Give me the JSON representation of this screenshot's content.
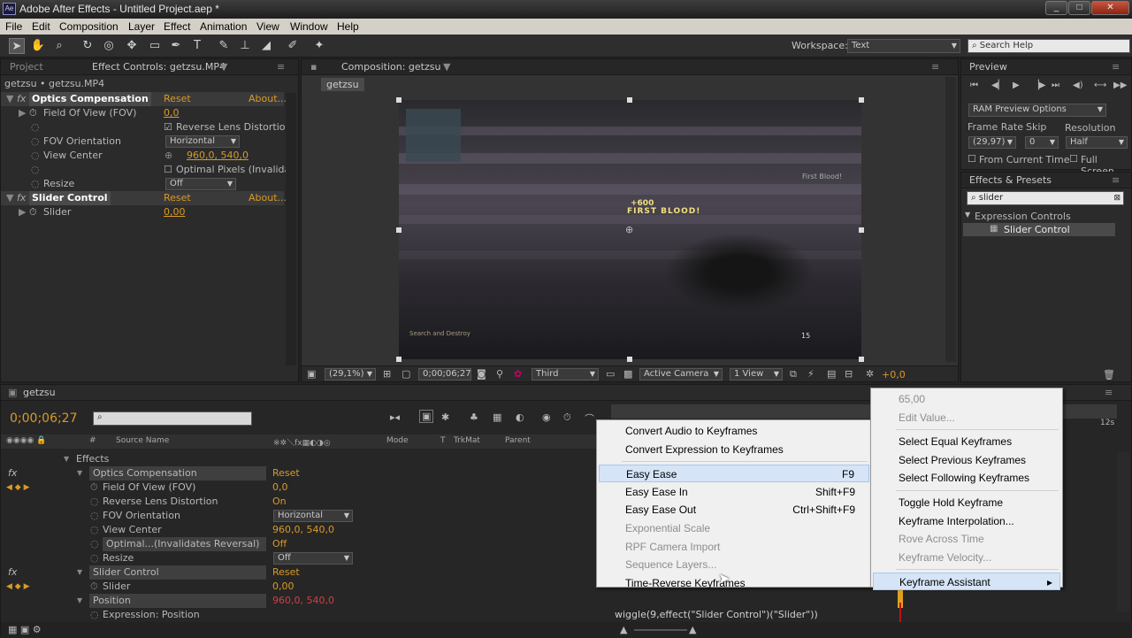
{
  "window": {
    "title": "Adobe After Effects - Untitled Project.aep *",
    "app_icon": "Ae",
    "min": "_",
    "max": "□",
    "close": "✕"
  },
  "menubar": {
    "items": [
      "File",
      "Edit",
      "Composition",
      "Layer",
      "Effect",
      "Animation",
      "View",
      "Window",
      "Help"
    ]
  },
  "toolbar": {
    "workspace_label": "Workspace:",
    "workspace_value": "Text",
    "search_placeholder": "Search Help"
  },
  "project_panel": {
    "tab_project": "Project",
    "tab_effect_controls": "Effect Controls: getzsu.MP4",
    "path": "getzsu • getzsu.MP4",
    "effects": [
      {
        "name": "Optics Compensation",
        "reset": "Reset",
        "about": "About...",
        "props": [
          {
            "name": "Field Of View (FOV)",
            "value": "0,0"
          },
          {
            "name": "",
            "value": "Reverse Lens Distortion",
            "checkbox": true,
            "checked": true
          },
          {
            "name": "FOV Orientation",
            "value": "Horizontal",
            "combo": true
          },
          {
            "name": "View Center",
            "value": "960,0, 540,0"
          },
          {
            "name": "",
            "value": "Optimal Pixels (Invalida",
            "checkbox": true,
            "checked": false
          },
          {
            "name": "Resize",
            "value": "Off",
            "combo": true
          }
        ]
      },
      {
        "name": "Slider Control",
        "reset": "Reset",
        "about": "About...",
        "props": [
          {
            "name": "Slider",
            "value": "0,00"
          }
        ]
      }
    ]
  },
  "composition_panel": {
    "tab": "Composition: getzsu",
    "breadcrumb": "getzsu",
    "overlay": {
      "score": "+600",
      "kill": "FIRST BLOOD!",
      "top_right": "First Blood!",
      "ammo": "15",
      "left_hud": "Search and Destroy"
    },
    "footer": {
      "zoom": "(29,1%)",
      "timecode": "0;00;06;27",
      "resolution": "Third",
      "camera": "Active Camera",
      "views": "1 View",
      "exposure": "+0,0"
    }
  },
  "preview_panel": {
    "tab": "Preview",
    "options": "RAM Preview Options",
    "frame_rate_label": "Frame Rate",
    "skip_label": "Skip",
    "resolution_label": "Resolution",
    "frame_rate": "(29,97)",
    "skip": "0",
    "resolution": "Half",
    "from_current": "From Current Time",
    "full_screen": "Full Screen"
  },
  "effects_presets": {
    "tab": "Effects & Presets",
    "search": "slider",
    "category": "Expression Controls",
    "item": "Slider Control"
  },
  "timeline": {
    "tab": "getzsu",
    "timecode": "0;00;06;27",
    "columns": {
      "source": "Source Name",
      "mode": "Mode",
      "t": "T",
      "trkmat": "TrkMat",
      "parent": "Parent",
      "num": "#"
    },
    "ruler_end": "12s",
    "rows": [
      {
        "indent": 1,
        "name": "Effects",
        "value": ""
      },
      {
        "indent": 2,
        "name": "Optics Compensation",
        "value": "Reset",
        "fx": true,
        "hl": true
      },
      {
        "indent": 3,
        "name": "Field Of View (FOV)",
        "value": "0,0",
        "sw": true
      },
      {
        "indent": 3,
        "name": "Reverse Lens Distortion",
        "value": "On"
      },
      {
        "indent": 3,
        "name": "FOV Orientation",
        "value": "Horizontal",
        "combo": true
      },
      {
        "indent": 3,
        "name": "View Center",
        "value": "960,0, 540,0"
      },
      {
        "indent": 3,
        "name": "Optimal...(Invalidates Reversal)",
        "value": "Off",
        "hl": true
      },
      {
        "indent": 3,
        "name": "Resize",
        "value": "Off",
        "combo": true
      },
      {
        "indent": 2,
        "name": "Slider Control",
        "value": "Reset",
        "fx": true,
        "hl": true
      },
      {
        "indent": 3,
        "name": "Slider",
        "value": "0,00",
        "sw": true
      },
      {
        "indent": 2,
        "name": "Position",
        "value": "960,0, 540,0",
        "hl": true,
        "red": true
      },
      {
        "indent": 3,
        "name": "Expression: Position",
        "value": ""
      }
    ],
    "expression": "wiggle(9,effect(\"Slider Control\")(\"Slider\"))"
  },
  "context_menu": {
    "items": [
      {
        "label": "Convert Audio to Keyframes",
        "shortcut": "",
        "disabled": false
      },
      {
        "label": "Convert Expression to Keyframes",
        "shortcut": "",
        "disabled": false
      },
      {
        "label": "Easy Ease",
        "shortcut": "F9",
        "disabled": false,
        "sep_before": true
      },
      {
        "label": "Easy Ease In",
        "shortcut": "Shift+F9",
        "disabled": false
      },
      {
        "label": "Easy Ease Out",
        "shortcut": "Ctrl+Shift+F9",
        "disabled": false
      },
      {
        "label": "Exponential Scale",
        "shortcut": "",
        "disabled": true
      },
      {
        "label": "RPF Camera Import",
        "shortcut": "",
        "disabled": true
      },
      {
        "label": "Sequence Layers...",
        "shortcut": "",
        "disabled": true
      },
      {
        "label": "Time-Reverse Keyframes",
        "shortcut": "",
        "disabled": false
      }
    ]
  },
  "parent_menu": {
    "items": [
      {
        "label": "65,00",
        "disabled": true
      },
      {
        "label": "Edit Value...",
        "disabled": true
      },
      {
        "label": "Select Equal Keyframes",
        "disabled": false,
        "sep_before": true
      },
      {
        "label": "Select Previous Keyframes",
        "disabled": false
      },
      {
        "label": "Select Following Keyframes",
        "disabled": false
      },
      {
        "label": "Toggle Hold Keyframe",
        "disabled": false,
        "sep_before": true
      },
      {
        "label": "Keyframe Interpolation...",
        "disabled": false
      },
      {
        "label": "Rove Across Time",
        "disabled": true
      },
      {
        "label": "Keyframe Velocity...",
        "disabled": true
      },
      {
        "label": "Keyframe Assistant",
        "disabled": false,
        "submenu": true,
        "sep_before": true
      }
    ]
  }
}
